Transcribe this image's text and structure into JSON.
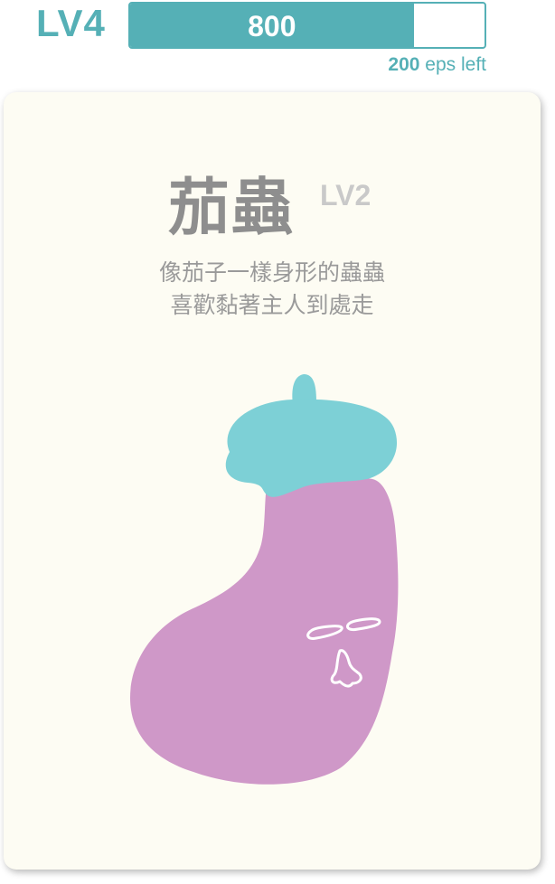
{
  "player": {
    "level": "LV4",
    "points": "800",
    "points_progress": 0.8,
    "remaining_count": "200",
    "remaining_suffix": " eps left"
  },
  "creature": {
    "name": "茄蟲",
    "level": "LV2",
    "description_lines": [
      "像茄子一樣身形的蟲蟲",
      "喜歡黏著主人到處走"
    ],
    "illustration": "eggplant-bug-illustration"
  },
  "colors": {
    "accent": "#55b0b6",
    "card_background": "#fdfcf3",
    "eggplant_body": "#cf98c8",
    "eggplant_cap": "#7dd0d6"
  }
}
